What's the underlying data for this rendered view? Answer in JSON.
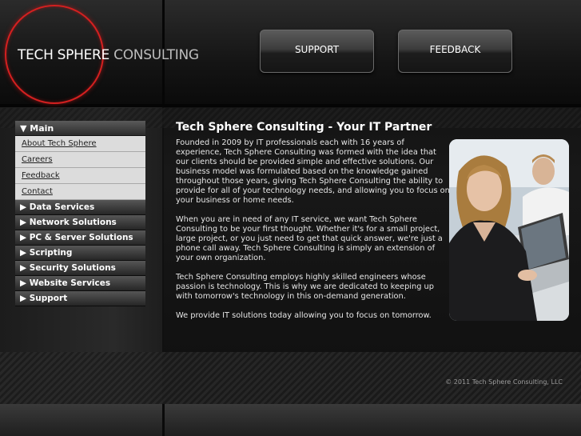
{
  "logo": {
    "part1": "TECH SPHERE",
    "part2": "CONSULTING"
  },
  "header": {
    "support_label": "SUPPORT",
    "feedback_label": "FEEDBACK"
  },
  "nav": {
    "main_label": "▼ Main",
    "sub_items": [
      "About Tech Sphere",
      "Careers",
      "Feedback",
      "Contact"
    ],
    "sections": [
      "▶ Data Services",
      "▶ Network Solutions",
      "▶ PC & Server Solutions",
      "▶ Scripting",
      "▶ Security Solutions",
      "▶ Website Services",
      "▶ Support"
    ]
  },
  "main": {
    "title": "Tech Sphere Consulting - Your IT Partner",
    "paragraphs": [
      "Founded in 2009 by IT professionals each with 16 years of experience, Tech Sphere Consulting was formed with the idea that our clients should be provided simple and effective solutions. Our business model was formulated based on the knowledge gained throughout those years, giving Tech Sphere Consulting the ability to provide for all of your technology needs, and allowing you to focus on your business or home needs.",
      "When you are in need of any IT service, we want Tech Sphere Consulting to be your first thought. Whether it's for a small project, large project, or you just need to get that quick answer, we're just a phone call away. Tech Sphere Consulting is simply an extension of your own organization.",
      "Tech Sphere Consulting employs highly skilled engineers whose passion is technology. This is why we are dedicated to keeping up with tomorrow's technology in this on-demand generation.",
      "We provide IT solutions today allowing you to focus on tomorrow."
    ]
  },
  "footer": {
    "copyright": "© 2011 Tech Sphere Consulting, LLC"
  },
  "colors": {
    "accent": "#d42020",
    "nav_sub_bg": "#dcdcdc"
  }
}
